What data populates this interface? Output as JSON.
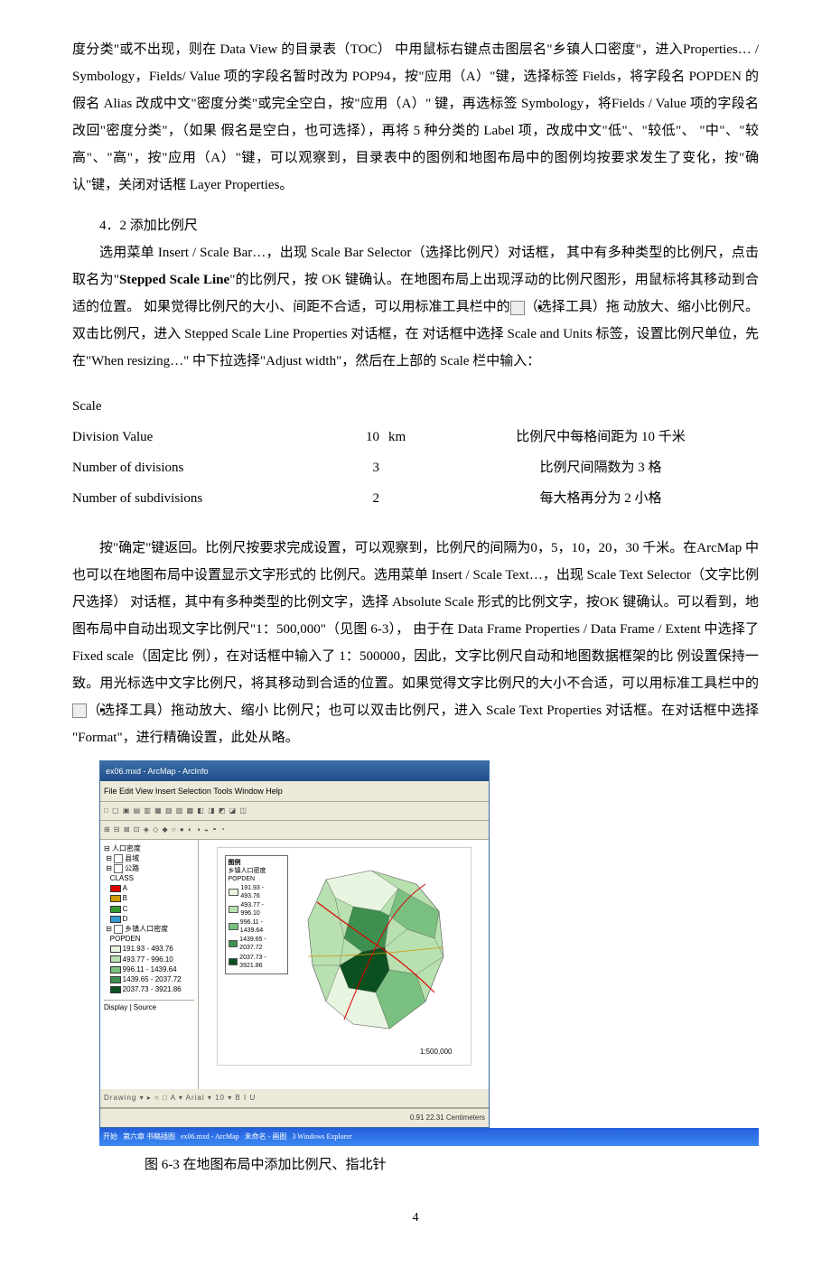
{
  "para1": "度分类\"或不出现，则在 Data View 的目录表（TOC） 中用鼠标右键点击图层名\"乡镇人口密度\"，进入Properties… / Symbology，Fields/ Value 项的字段名暂时改为 POP94，按\"应用（A）\"键，选择标签 Fields，将字段名 POPDEN 的假名 Alias 改成中文\"密度分类\"或完全空白，按\"应用（A）\" 键，再选标签 Symbology，将Fields / Value 项的字段名改回\"密度分类\"，（如果 假名是空白，也可选择），再将 5 种分类的 Label 项，改成中文\"低\"、\"较低\"、 \"中\"、\"较高\"、\"高\"，按\"应用（A）\"键，可以观察到，目录表中的图例和地图布局中的图例均按要求发生了变化，按\"确认\"键，关闭对话框 Layer Properties。",
  "section_title": "4．2  添加比例尺",
  "para2a": "选用菜单 Insert / Scale Bar…，出现 Scale Bar Selector（选择比例尺）对话框， 其中有多种类型的比例尺，点击取名为\"",
  "para2b_bold": "Stepped  Scale  Line",
  "para2c": "\"的比例尺，按 OK 键确认。在地图布局上出现浮动的比例尺图形，用鼠标将其移动到合适的位置。 如果觉得比例尺的大小、间距不合适，可以用标准工具栏中的",
  "para2d": "（选择工具）拖 动放大、缩小比例尺。双击比例尺，进入 Stepped Scale Line Properties 对话框，在 对话框中选择 Scale and Units 标签，设置比例尺单位，先在\"When resizing…\" 中下拉选择\"Adjust width\"，然后在上部的 Scale 栏中输入：",
  "scale_table": {
    "header": "Scale",
    "rows": [
      {
        "label": "Division Value",
        "value": "10",
        "unit": "km",
        "desc": "比例尺中每格间距为 10 千米"
      },
      {
        "label": "Number of divisions",
        "value": "3",
        "unit": "",
        "desc": "比例尺间隔数为 3 格"
      },
      {
        "label": "Number of subdivisions",
        "value": "2",
        "unit": "",
        "desc": "每大格再分为 2 小格"
      }
    ]
  },
  "para3a": "按\"确定\"键返回。比例尺按要求完成设置，可以观察到，比例尺的间隔为0，5，10，20，30 千米。在ArcMap 中也可以在地图布局中设置显示文字形式的 比例尺。选用菜单 Insert / Scale Text…，出现 Scale Text Selector（文字比例尺选择） 对话框，其中有多种类型的比例文字，选择 Absolute  Scale 形式的比例文字，按OK 键确认。可以看到，地图布局中自动出现文字比例尺\"1：500,000\"（见图 6-3）， 由于在 Data Frame Properties / Data Frame / Extent 中选择了 Fixed scale（固定比 例），在对话框中输入了 1：500000，因此，文字比例尺自动和地图数据框架的比 例设置保持一致。用光标选中文字比例尺，将其移动到合适的位置。如果觉得文字比例尺的大小不合适，可以用标准工具栏中的",
  "para3b": "（选择工具）拖动放大、缩小 比例尺；也可以双击比例尺，进入 Scale Text Properties 对话框。在对话框中选择 \"Format\"，进行精确设置，此处从略。",
  "arcmap": {
    "title": "ex06.mxd - ArcMap - ArcInfo",
    "menu": "File  Edit  View  Insert  Selection  Tools  Window  Help",
    "toc_root": "人口密度",
    "toc_layer1": "县域",
    "toc_layer2": "公路",
    "toc_class": "CLASS",
    "toc_classes": [
      "A",
      "B",
      "C",
      "D"
    ],
    "toc_layer3": "乡镇人口密度",
    "toc_field": "POPDEN",
    "toc_breaks": [
      "191.93 - 493.76",
      "493.77 - 996.10",
      "996.11 - 1439.64",
      "1439.65 - 2037.72",
      "2037.73 - 3921.86"
    ],
    "legend_title": "图例",
    "legend_sub": "乡镇人口密度",
    "legend_field": "POPDEN",
    "scale_text": "1:500,000",
    "status": "0.91 22.31 Centimeters",
    "tab1": "Display",
    "tab2": "Source",
    "drawing": "Drawing"
  },
  "taskbar": {
    "start": "开始",
    "items": [
      "第六章 书稿插图",
      "ex06.mxd - ArcMap",
      "未命名 - 画图",
      "3 Windows Explorer"
    ]
  },
  "fig_caption": "图 6-3  在地图布局中添加比例尺、指北针",
  "page_number": "4"
}
